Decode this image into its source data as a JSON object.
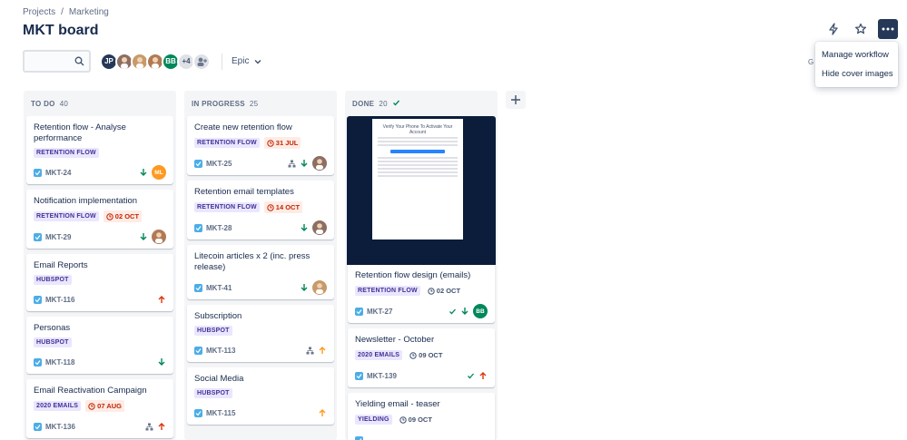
{
  "breadcrumb": {
    "items": [
      "Projects",
      "Marketing"
    ],
    "separator": "/"
  },
  "page": {
    "title": "MKT board"
  },
  "toolbar": {
    "epic_label": "Epic",
    "avatars": [
      {
        "initials": "JP",
        "color": "#253858"
      },
      {
        "initials": "",
        "color": "#8d6e63"
      },
      {
        "initials": "",
        "color": "#c79a6b"
      },
      {
        "initials": "",
        "color": "#b07a57"
      },
      {
        "initials": "BB",
        "color": "#00875a"
      },
      {
        "initials": "+4",
        "color": "#dfe1e6"
      }
    ],
    "cut_text": "G"
  },
  "menu": {
    "items": [
      "Manage workflow",
      "Hide cover images"
    ]
  },
  "columns": [
    {
      "name": "TO DO",
      "count": "40",
      "cards": [
        {
          "title": "Retention flow - Analyse performance",
          "tag": "RETENTION FLOW",
          "date": "",
          "key": "MKT-24",
          "priority": "low",
          "avatar": "ML",
          "avatar_color": "#ff991f"
        },
        {
          "title": "Notification implementation",
          "tag": "RETENTION FLOW",
          "date": "02 OCT",
          "key": "MKT-29",
          "priority": "low",
          "avatar": "",
          "avatar_color": "#b07a57"
        },
        {
          "title": "Email Reports",
          "tag": "HUBSPOT",
          "date": "",
          "key": "MKT-116",
          "priority": "high",
          "avatar": "",
          "avatar_color": ""
        },
        {
          "title": "Personas",
          "tag": "HUBSPOT",
          "date": "",
          "key": "MKT-118",
          "priority": "low",
          "avatar": "",
          "avatar_color": ""
        },
        {
          "title": "Email Reactivation Campaign",
          "tag": "2020 EMAILS",
          "date": "07 AUG",
          "key": "MKT-136",
          "priority": "high",
          "avatar": "",
          "avatar_color": ""
        }
      ]
    },
    {
      "name": "IN PROGRESS",
      "count": "25",
      "cards": [
        {
          "title": "Create new retention flow",
          "tag": "RETENTION FLOW",
          "date": "31 JUL",
          "key": "MKT-25",
          "priority": "low",
          "avatar": "",
          "avatar_color": "#8d6e63"
        },
        {
          "title": "Retention email templates",
          "tag": "RETENTION FLOW",
          "date": "14 OCT",
          "key": "MKT-28",
          "priority": "low",
          "avatar": "",
          "avatar_color": "#8d6e63"
        },
        {
          "title": "Litecoin articles x 2 (inc. press release)",
          "tag": "",
          "date": "",
          "key": "MKT-41",
          "priority": "low",
          "avatar": "",
          "avatar_color": "#c79a6b"
        },
        {
          "title": "Subscription",
          "tag": "HUBSPOT",
          "date": "",
          "key": "MKT-113",
          "priority": "medium",
          "avatar": "",
          "avatar_color": ""
        },
        {
          "title": "Social Media",
          "tag": "HUBSPOT",
          "date": "",
          "key": "MKT-115",
          "priority": "medium",
          "avatar": "",
          "avatar_color": ""
        }
      ]
    },
    {
      "name": "DONE",
      "count": "20",
      "cover": {
        "title": "Verify Your Phone To Activate Your Account"
      },
      "cards": [
        {
          "title": "Retention flow design (emails)",
          "tag": "RETENTION FLOW",
          "date": "02 OCT",
          "key": "MKT-27",
          "priority": "low",
          "avatar": "BB",
          "avatar_color": "#00875a"
        },
        {
          "title": "Newsletter - October",
          "tag": "2020 EMAILS",
          "date": "09 OCT",
          "key": "MKT-139",
          "priority": "high",
          "avatar": "",
          "avatar_color": ""
        },
        {
          "title": "Yielding email - teaser",
          "tag": "YIELDING",
          "date": "09 OCT",
          "key": "",
          "priority": "",
          "avatar": "",
          "avatar_color": ""
        }
      ]
    }
  ],
  "colors": {
    "accent": "#0052cc",
    "dark_button": "#253858",
    "priority_high": "#de350b",
    "priority_low": "#00875a",
    "priority_medium": "#ff991f"
  }
}
